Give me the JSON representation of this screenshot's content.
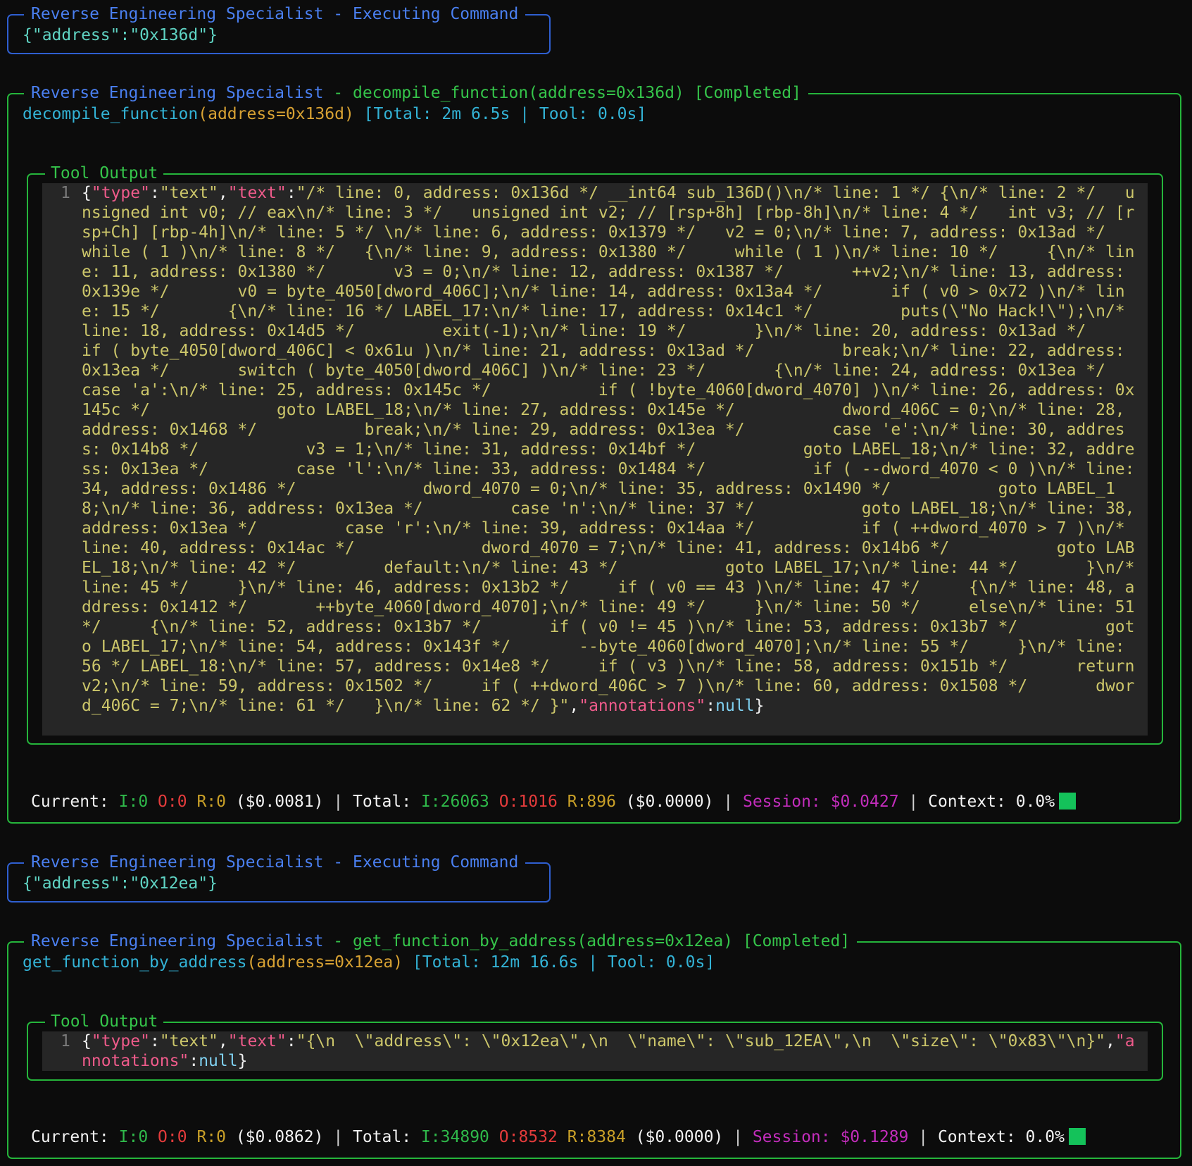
{
  "colors": {
    "border_blue": "#2f5fd0",
    "border_green": "#25b53b",
    "background": "#0c0c0c",
    "code_bg": "#262626",
    "code_text": "#ccc66a",
    "context_indicator": "#14c25a"
  },
  "block1": {
    "title_agent": "Reverse Engineering Specialist",
    "title_sep": " - ",
    "title_status": "Executing Command",
    "command": "{\"address\":\"0x136d\"}"
  },
  "block2": {
    "title_agent": "Reverse Engineering Specialist",
    "title_sep": " - ",
    "title_call": "decompile_function(address=0x136d) [Completed]",
    "fn_name": "decompile_function",
    "fn_args": "(address=0x136d)",
    "timing": " [Total: 2m 6.5s | Tool: 0.0s]",
    "tool_output_label": "Tool Output",
    "line_number": "1",
    "out_open": "{",
    "k_type": "\"type\"",
    "colon1": ":",
    "v_type": "\"text\"",
    "comma1": ",",
    "k_text": "\"text\"",
    "colon2": ":",
    "v_text": "\"/* line: 0, address: 0x136d */ __int64 sub_136D()\\n/* line: 1 */ {\\n/* line: 2 */   unsigned int v0; // eax\\n/* line: 3 */   unsigned int v2; // [rsp+8h] [rbp-8h]\\n/* line: 4 */   int v3; // [rsp+Ch] [rbp-4h]\\n/* line: 5 */ \\n/* line: 6, address: 0x1379 */   v2 = 0;\\n/* line: 7, address: 0x13ad */   while ( 1 )\\n/* line: 8 */   {\\n/* line: 9, address: 0x1380 */     while ( 1 )\\n/* line: 10 */     {\\n/* line: 11, address: 0x1380 */       v3 = 0;\\n/* line: 12, address: 0x1387 */       ++v2;\\n/* line: 13, address: 0x139e */       v0 = byte_4050[dword_406C];\\n/* line: 14, address: 0x13a4 */       if ( v0 > 0x72 )\\n/* line: 15 */       {\\n/* line: 16 */ LABEL_17:\\n/* line: 17, address: 0x14c1 */         puts(\\\"No Hack!\\\");\\n/* line: 18, address: 0x14d5 */         exit(-1);\\n/* line: 19 */       }\\n/* line: 20, address: 0x13ad */       if ( byte_4050[dword_406C] < 0x61u )\\n/* line: 21, address: 0x13ad */         break;\\n/* line: 22, address: 0x13ea */       switch ( byte_4050[dword_406C] )\\n/* line: 23 */       {\\n/* line: 24, address: 0x13ea */         case 'a':\\n/* line: 25, address: 0x145c */           if ( !byte_4060[dword_4070] )\\n/* line: 26, address: 0x145c */             goto LABEL_18;\\n/* line: 27, address: 0x145e */           dword_406C = 0;\\n/* line: 28, address: 0x1468 */           break;\\n/* line: 29, address: 0x13ea */         case 'e':\\n/* line: 30, address: 0x14b8 */           v3 = 1;\\n/* line: 31, address: 0x14bf */           goto LABEL_18;\\n/* line: 32, address: 0x13ea */         case 'l':\\n/* line: 33, address: 0x1484 */           if ( --dword_4070 < 0 )\\n/* line: 34, address: 0x1486 */             dword_4070 = 0;\\n/* line: 35, address: 0x1490 */           goto LABEL_18;\\n/* line: 36, address: 0x13ea */         case 'n':\\n/* line: 37 */           goto LABEL_18;\\n/* line: 38, address: 0x13ea */         case 'r':\\n/* line: 39, address: 0x14aa */           if ( ++dword_4070 > 7 )\\n/* line: 40, address: 0x14ac */             dword_4070 = 7;\\n/* line: 41, address: 0x14b6 */           goto LABEL_18;\\n/* line: 42 */         default:\\n/* line: 43 */           goto LABEL_17;\\n/* line: 44 */       }\\n/* line: 45 */     }\\n/* line: 46, address: 0x13b2 */     if ( v0 == 43 )\\n/* line: 47 */     {\\n/* line: 48, address: 0x1412 */       ++byte_4060[dword_4070];\\n/* line: 49 */     }\\n/* line: 50 */     else\\n/* line: 51 */     {\\n/* line: 52, address: 0x13b7 */       if ( v0 != 45 )\\n/* line: 53, address: 0x13b7 */         goto LABEL_17;\\n/* line: 54, address: 0x143f */       --byte_4060[dword_4070];\\n/* line: 55 */     }\\n/* line: 56 */ LABEL_18:\\n/* line: 57, address: 0x14e8 */     if ( v3 )\\n/* line: 58, address: 0x151b */       return v2;\\n/* line: 59, address: 0x1502 */     if ( ++dword_406C > 7 )\\n/* line: 60, address: 0x1508 */       dword_406C = 7;\\n/* line: 61 */   }\\n/* line: 62 */ }\"",
    "comma2": ",",
    "k_ann": "\"annotations\"",
    "colon3": ":",
    "v_ann": "null",
    "out_close": "}",
    "status": {
      "current_label": "Current: ",
      "current_i": "I:0",
      "current_o": "O:0",
      "current_r": "R:0",
      "current_cost": " ($0.0081)",
      "sep1": " | ",
      "total_label": "Total: ",
      "total_i": "I:26063",
      "total_o": "O:1016",
      "total_r": "R:896",
      "total_cost": " ($0.0000)",
      "sep2": " | ",
      "session_label": "Session: ",
      "session_cost": "$0.0427",
      "sep3": " | ",
      "context_label": "Context: 0.0%"
    }
  },
  "block3": {
    "title_agent": "Reverse Engineering Specialist",
    "title_sep": " - ",
    "title_status": "Executing Command",
    "command": "{\"address\":\"0x12ea\"}"
  },
  "block4": {
    "title_agent": "Reverse Engineering Specialist",
    "title_sep": " - ",
    "title_call": "get_function_by_address(address=0x12ea) [Completed]",
    "fn_name": "get_function_by_address",
    "fn_args": "(address=0x12ea)",
    "timing": " [Total: 12m 16.6s | Tool: 0.0s]",
    "tool_output_label": "Tool Output",
    "line_number": "1",
    "out_open": "{",
    "k_type": "\"type\"",
    "colon1": ":",
    "v_type": "\"text\"",
    "comma1": ",",
    "k_text": "\"text\"",
    "colon2": ":",
    "v_text": "\"{\\n  \\\"address\\\": \\\"0x12ea\\\",\\n  \\\"name\\\": \\\"sub_12EA\\\",\\n  \\\"size\\\": \\\"0x83\\\"\\n}\"",
    "comma2": ",",
    "k_ann": "\"annotations\"",
    "colon3": ":",
    "v_ann": "null",
    "out_close": "}",
    "status": {
      "current_label": "Current: ",
      "current_i": "I:0",
      "current_o": "O:0",
      "current_r": "R:0",
      "current_cost": " ($0.0862)",
      "sep1": " | ",
      "total_label": "Total: ",
      "total_i": "I:34890",
      "total_o": "O:8532",
      "total_r": "R:8384",
      "total_cost": " ($0.0000)",
      "sep2": " | ",
      "session_label": "Session: ",
      "session_cost": "$0.1289",
      "sep3": " | ",
      "context_label": "Context: 0.0%"
    }
  }
}
